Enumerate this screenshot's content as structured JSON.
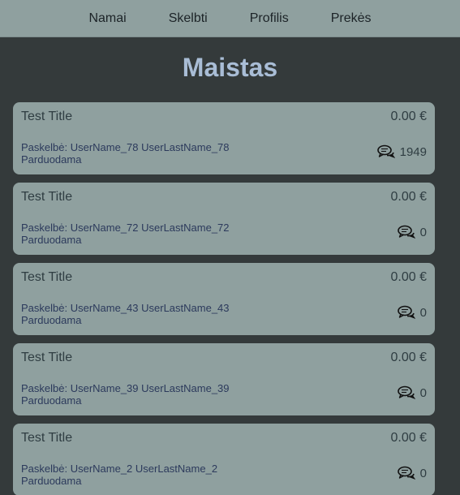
{
  "nav": {
    "items": [
      "Namai",
      "Skelbti",
      "Profilis",
      "Prekės"
    ]
  },
  "page": {
    "title": "Maistas"
  },
  "listings": [
    {
      "title": "Test Title",
      "price": "0.00 €",
      "author": "Paskelbė: UserName_78 UserLastName_78",
      "status": "Parduodama",
      "comments": "1949"
    },
    {
      "title": "Test Title",
      "price": "0.00 €",
      "author": "Paskelbė: UserName_72 UserLastName_72",
      "status": "Parduodama",
      "comments": "0"
    },
    {
      "title": "Test Title",
      "price": "0.00 €",
      "author": "Paskelbė: UserName_43 UserLastName_43",
      "status": "Parduodama",
      "comments": "0"
    },
    {
      "title": "Test Title",
      "price": "0.00 €",
      "author": "Paskelbė: UserName_39 UserLastName_39",
      "status": "Parduodama",
      "comments": "0"
    },
    {
      "title": "Test Title",
      "price": "0.00 €",
      "author": "Paskelbė: UserName_2 UserLastName_2",
      "status": "Parduodama",
      "comments": "0"
    }
  ],
  "colors": {
    "background": "#343a3b",
    "nav_background": "#8fa09f",
    "card_background": "#8fa09f",
    "title": "#a9bdd6"
  },
  "icons": {
    "comments": "chat-bubbles-icon"
  }
}
